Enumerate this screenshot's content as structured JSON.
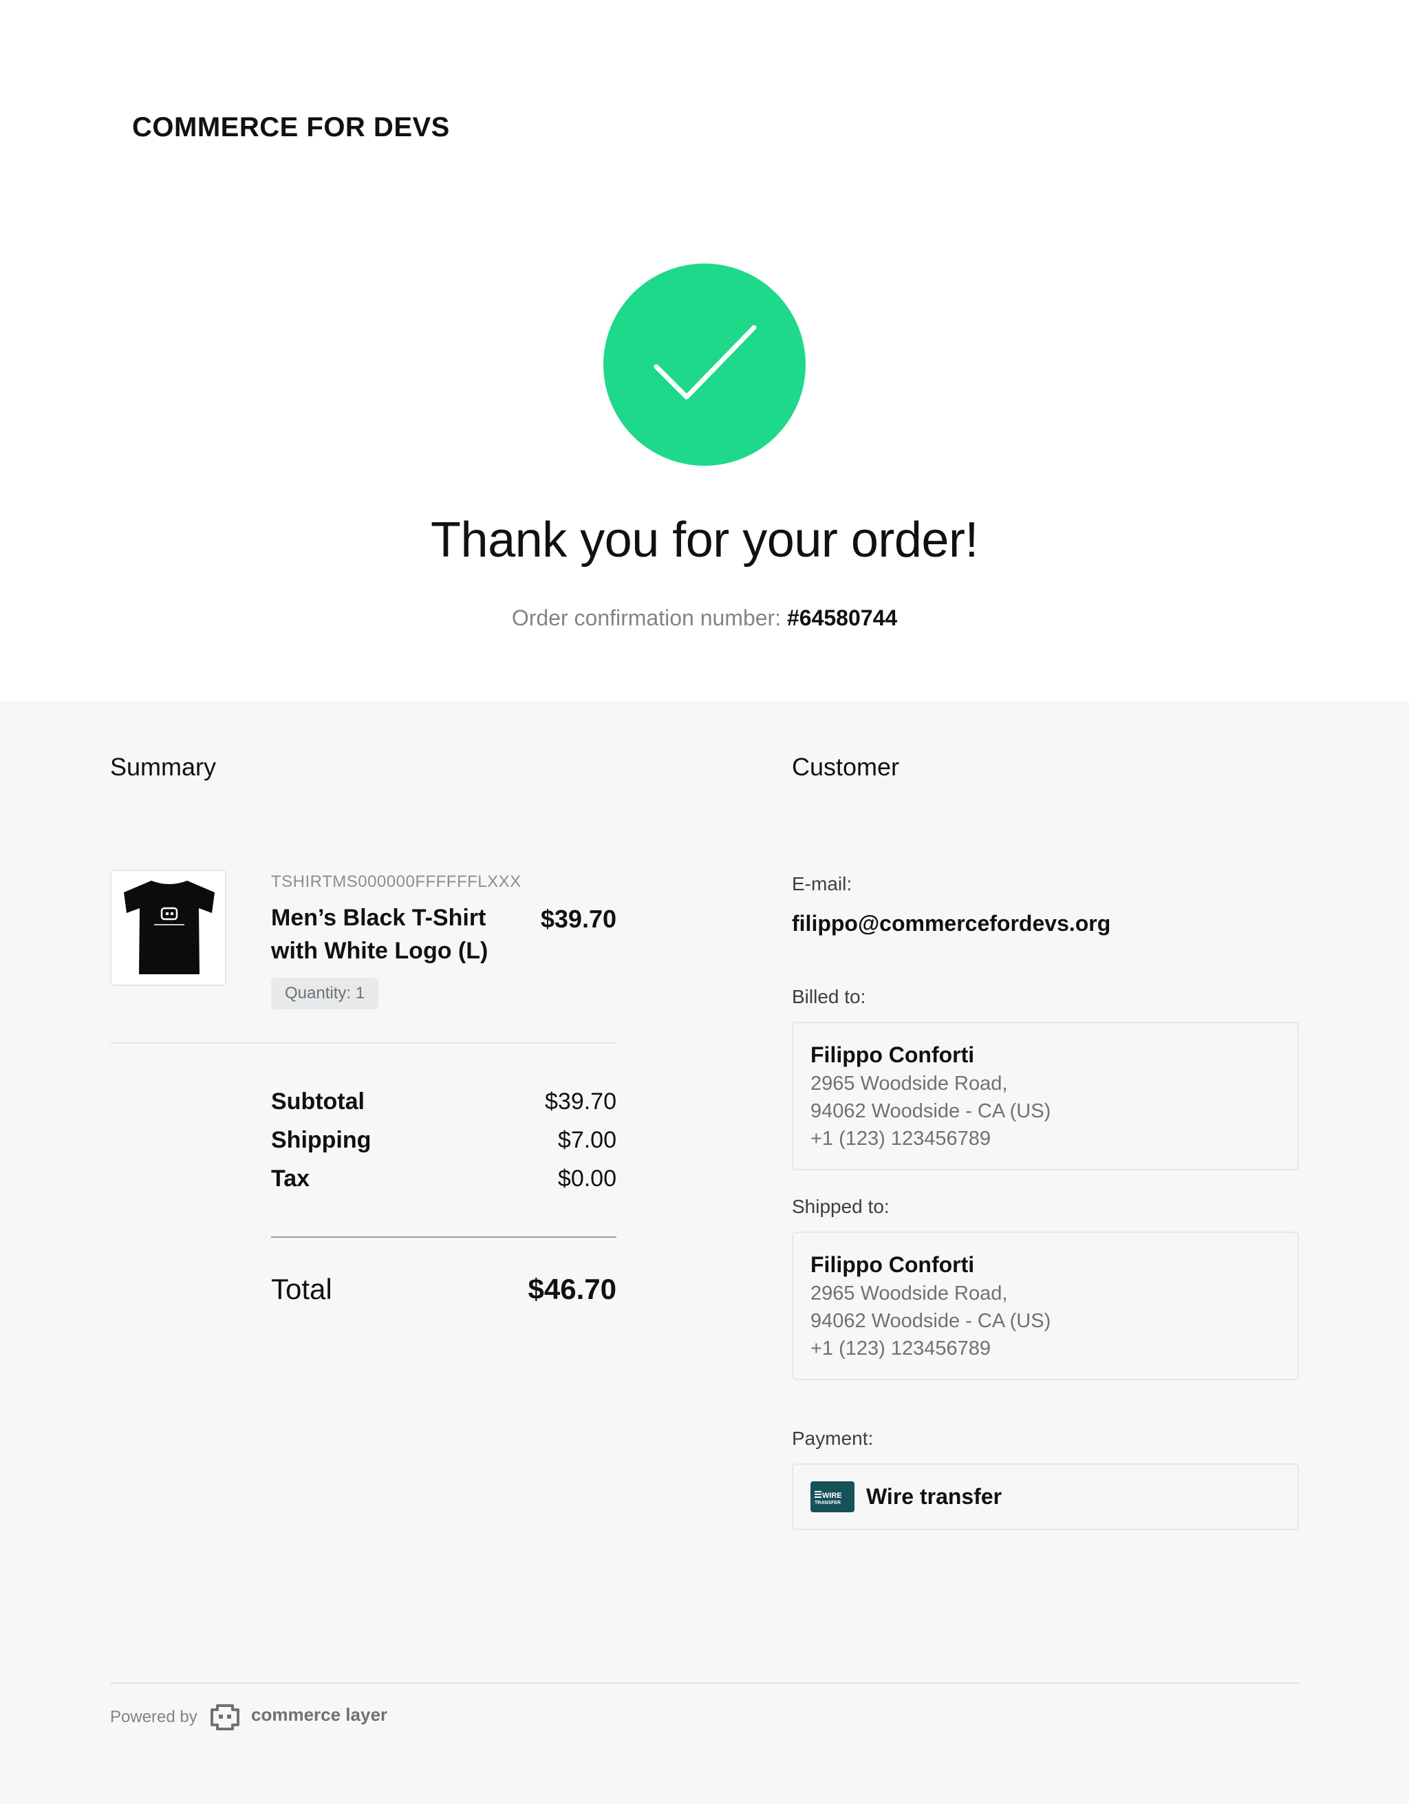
{
  "header": {
    "brand": "COMMERCE FOR DEVS"
  },
  "confirmation": {
    "icon": "check-circle-icon",
    "accent_color": "#1fd98a",
    "title": "Thank you for your order!",
    "order_label": "Order confirmation number:",
    "order_number": "#64580744"
  },
  "summary": {
    "title": "Summary",
    "item": {
      "sku": "TSHIRTMS000000FFFFFFLXXX",
      "name": "Men’s Black T-Shirt with White Logo (L)",
      "price": "$39.70",
      "quantity": "Quantity: 1",
      "image": "black-tshirt-image"
    },
    "totals": {
      "subtotal_label": "Subtotal",
      "subtotal_value": "$39.70",
      "shipping_label": "Shipping",
      "shipping_value": "$7.00",
      "tax_label": "Tax",
      "tax_value": "$0.00",
      "total_label": "Total",
      "total_value": "$46.70"
    }
  },
  "customer": {
    "title": "Customer",
    "email_label": "E-mail:",
    "email": "filippo@commercefordevs.org",
    "billing": {
      "label": "Billed to:",
      "name": "Filippo Conforti",
      "line1": "2965 Woodside Road,",
      "line2": "94062 Woodside - CA (US)",
      "phone": "+1 (123) 123456789"
    },
    "shipping": {
      "label": "Shipped to:",
      "name": "Filippo Conforti",
      "line1": "2965 Woodside Road,",
      "line2": "94062 Woodside - CA (US)",
      "phone": "+1 (123) 123456789"
    },
    "payment": {
      "label": "Payment:",
      "method": "Wire transfer",
      "logo_text_top": "WIRE",
      "logo_text_bottom": "TRANSFER",
      "icon": "wire-transfer-icon"
    }
  },
  "footer": {
    "powered_by": "Powered by",
    "logo_icon": "commerce-layer-logo-icon",
    "logo_text": "commerce layer"
  }
}
